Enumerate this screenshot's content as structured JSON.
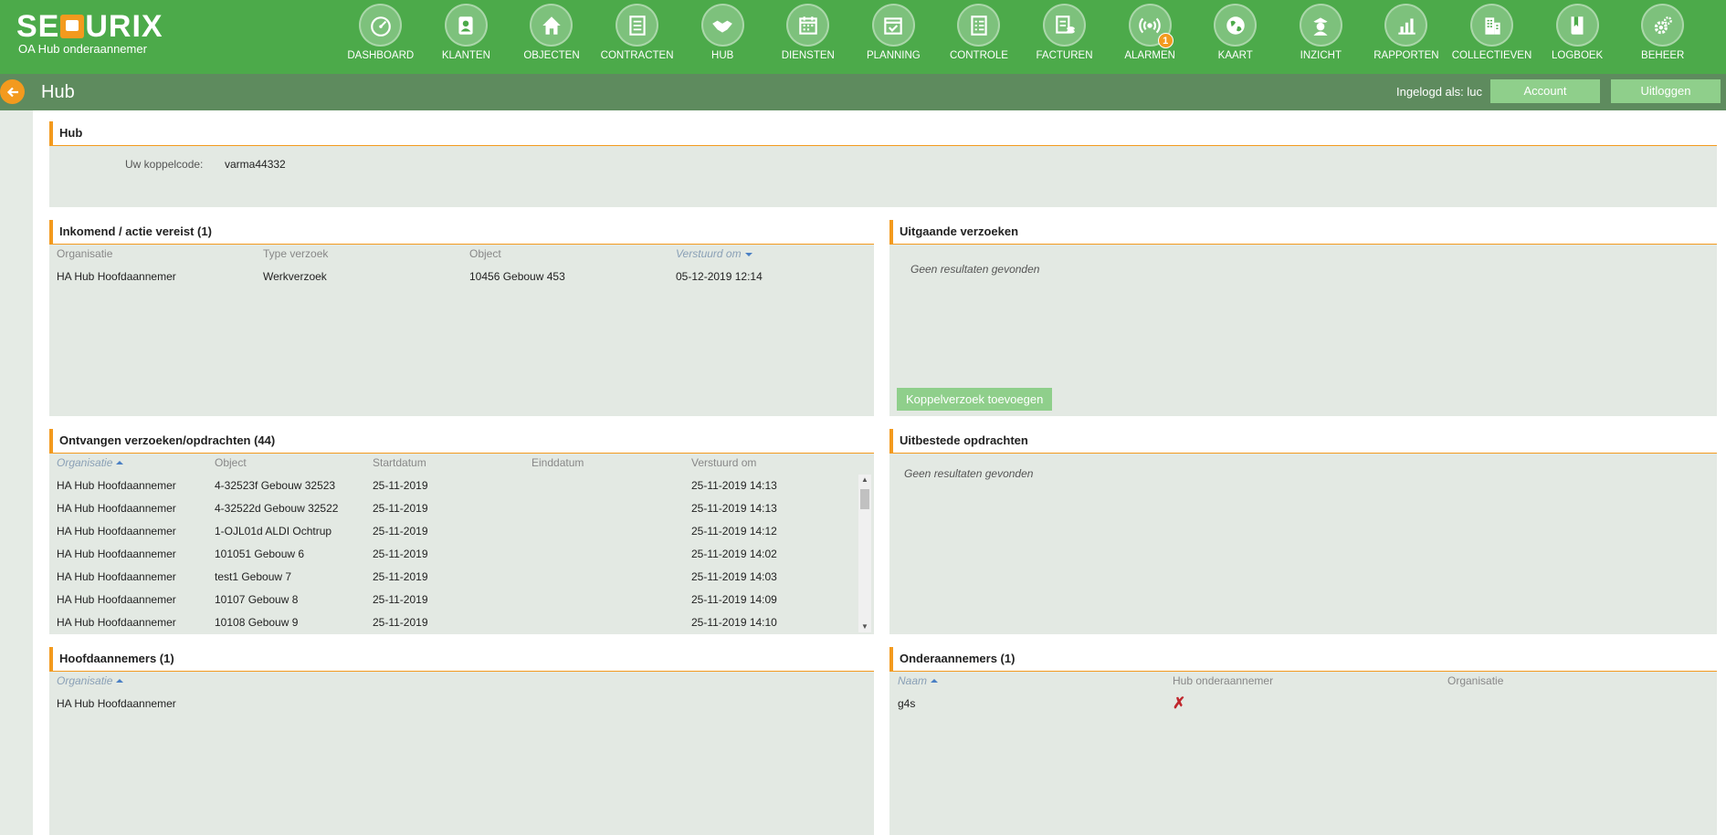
{
  "app": {
    "logo_text": "SEQURIX",
    "subtitle": "OA Hub onderaannemer"
  },
  "nav": [
    {
      "label": "DASHBOARD",
      "icon": "speedometer-icon"
    },
    {
      "label": "KLANTEN",
      "icon": "address-book-icon"
    },
    {
      "label": "OBJECTEN",
      "icon": "home-icon"
    },
    {
      "label": "CONTRACTEN",
      "icon": "document-icon"
    },
    {
      "label": "HUB",
      "icon": "handshake-icon"
    },
    {
      "label": "DIENSTEN",
      "icon": "calendar-icon"
    },
    {
      "label": "PLANNING",
      "icon": "calendar-check-icon"
    },
    {
      "label": "CONTROLE",
      "icon": "checklist-icon"
    },
    {
      "label": "FACTUREN",
      "icon": "invoice-icon"
    },
    {
      "label": "ALARMEN",
      "icon": "alarm-signal-icon",
      "badge": "1"
    },
    {
      "label": "KAART",
      "icon": "globe-icon"
    },
    {
      "label": "INZICHT",
      "icon": "guard-icon"
    },
    {
      "label": "RAPPORTEN",
      "icon": "bar-chart-icon"
    },
    {
      "label": "COLLECTIEVEN",
      "icon": "building-icon"
    },
    {
      "label": "LOGBOEK",
      "icon": "book-icon"
    },
    {
      "label": "BEHEER",
      "icon": "gears-icon"
    }
  ],
  "header": {
    "title": "Hub",
    "login_label": "Ingelogd als: luc",
    "account_button": "Account",
    "logout_button": "Uitloggen"
  },
  "hub_panel": {
    "title": "Hub",
    "code_label": "Uw koppelcode:",
    "code_value": "varma44332"
  },
  "incoming": {
    "title": "Inkomend / actie vereist (1)",
    "columns": [
      "Organisatie",
      "Type verzoek",
      "Object",
      "Verstuurd om"
    ],
    "rows": [
      [
        "HA Hub Hoofdaannemer",
        "Werkverzoek",
        "10456 Gebouw 453",
        "05-12-2019 12:14"
      ]
    ]
  },
  "outgoing": {
    "title": "Uitgaande verzoeken",
    "empty_text": "Geen resultaten gevonden",
    "add_button": "Koppelverzoek toevoegen"
  },
  "received": {
    "title": "Ontvangen verzoeken/opdrachten (44)",
    "columns": [
      "Organisatie",
      "Object",
      "Startdatum",
      "Einddatum",
      "Verstuurd om"
    ],
    "rows": [
      [
        "HA Hub Hoofdaannemer",
        "4-32523f Gebouw 32523",
        "25-11-2019",
        "",
        "25-11-2019 14:13"
      ],
      [
        "HA Hub Hoofdaannemer",
        "4-32522d Gebouw 32522",
        "25-11-2019",
        "",
        "25-11-2019 14:13"
      ],
      [
        "HA Hub Hoofdaannemer",
        "1-OJL01d ALDI Ochtrup",
        "25-11-2019",
        "",
        "25-11-2019 14:12"
      ],
      [
        "HA Hub Hoofdaannemer",
        "101051 Gebouw 6",
        "25-11-2019",
        "",
        "25-11-2019 14:02"
      ],
      [
        "HA Hub Hoofdaannemer",
        "test1 Gebouw 7",
        "25-11-2019",
        "",
        "25-11-2019 14:03"
      ],
      [
        "HA Hub Hoofdaannemer",
        "10107 Gebouw 8",
        "25-11-2019",
        "",
        "25-11-2019 14:09"
      ],
      [
        "HA Hub Hoofdaannemer",
        "10108 Gebouw 9",
        "25-11-2019",
        "",
        "25-11-2019 14:10"
      ]
    ]
  },
  "outsourced": {
    "title": "Uitbestede opdrachten",
    "empty_text": "Geen resultaten gevonden"
  },
  "main_contractors": {
    "title": "Hoofdaannemers (1)",
    "columns": [
      "Organisatie"
    ],
    "rows": [
      [
        "HA Hub Hoofdaannemer"
      ]
    ]
  },
  "subcontractors": {
    "title": "Onderaannemers (1)",
    "columns": [
      "Naam",
      "Hub onderaannemer",
      "Organisatie"
    ],
    "rows": [
      [
        "g4s",
        "✗",
        ""
      ]
    ]
  },
  "colors": {
    "brand_green": "#4caa4a",
    "subbar_green": "#5e8b5e",
    "accent_orange": "#f39a1e",
    "button_green": "#8fcf8b",
    "cross_red": "#c0272d"
  }
}
